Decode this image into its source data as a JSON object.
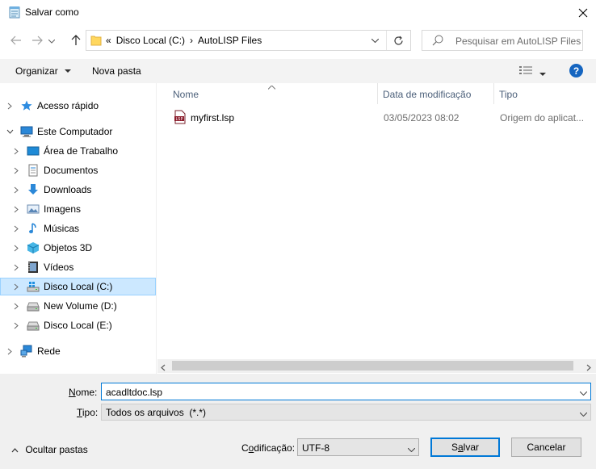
{
  "window": {
    "title": "Salvar como"
  },
  "address": {
    "crumbs": [
      "«",
      "Disco Local (C:)",
      "›",
      "AutoLISP Files"
    ]
  },
  "search": {
    "placeholder": "Pesquisar em AutoLISP Files"
  },
  "toolbar": {
    "organize": "Organizar",
    "new_folder": "Nova pasta",
    "help": "?"
  },
  "nav": {
    "items": [
      {
        "label": "Acesso rápido",
        "icon": "star-icon"
      },
      {
        "label": "Este Computador",
        "icon": "computer-icon"
      },
      {
        "label": "Área de Trabalho",
        "icon": "desktop-icon"
      },
      {
        "label": "Documentos",
        "icon": "documents-icon"
      },
      {
        "label": "Downloads",
        "icon": "downloads-icon"
      },
      {
        "label": "Imagens",
        "icon": "pictures-icon"
      },
      {
        "label": "Músicas",
        "icon": "music-icon"
      },
      {
        "label": "Objetos 3D",
        "icon": "objects3d-icon"
      },
      {
        "label": "Vídeos",
        "icon": "videos-icon"
      },
      {
        "label": "Disco Local (C:)",
        "icon": "drive-icon"
      },
      {
        "label": "New Volume (D:)",
        "icon": "drive-icon"
      },
      {
        "label": "Disco Local (E:)",
        "icon": "drive-icon"
      },
      {
        "label": "Rede",
        "icon": "network-icon"
      }
    ]
  },
  "filelist": {
    "columns": [
      "Nome",
      "Data de modificação",
      "Tipo"
    ],
    "rows": [
      {
        "name": "myfirst.lsp",
        "date": "03/05/2023 08:02",
        "type": "Origem do aplicat..."
      }
    ]
  },
  "form": {
    "name_label_u": "N",
    "name_label_rest": "ome:",
    "name_value": "acadltdoc.lsp",
    "type_label_u": "T",
    "type_label_rest": "ipo:",
    "type_value": "Todos os arquivos  (*.*)",
    "encoding_label_pre": "C",
    "encoding_label_u": "o",
    "encoding_label_rest": "dificação:",
    "encoding_value": "UTF-8",
    "hide_folders": "Ocultar pastas",
    "save_pre": "S",
    "save_u": "a",
    "save_rest": "lvar",
    "cancel": "Cancelar"
  },
  "colors": {
    "accent": "#0078d7",
    "selected_bg": "#cce8ff",
    "header_text": "#4c607a"
  }
}
